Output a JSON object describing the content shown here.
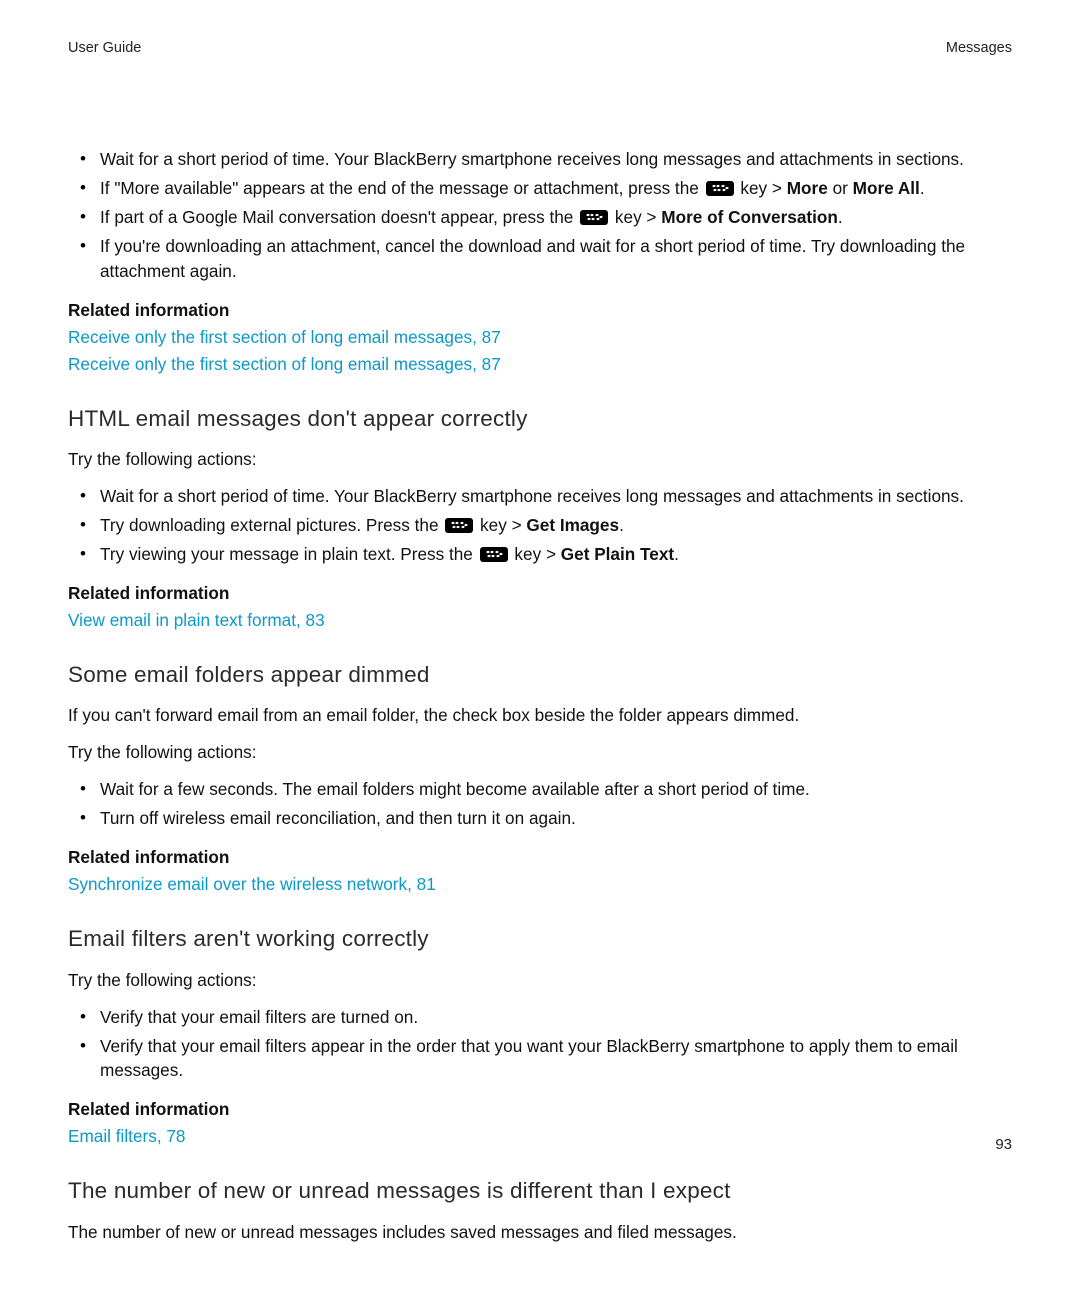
{
  "header": {
    "left": "User Guide",
    "right": "Messages"
  },
  "top_bullets": {
    "b1": "Wait for a short period of time. Your BlackBerry smartphone receives long messages and attachments in sections.",
    "b2a": "If \"More available\" appears at the end of the message or attachment, press the ",
    "b2b": " key > ",
    "b2c": "More",
    "b2d": " or ",
    "b2e": "More All",
    "b2f": ".",
    "b3a": "If part of a Google Mail conversation doesn't appear, press the ",
    "b3b": " key > ",
    "b3c": "More of Conversation",
    "b3d": ".",
    "b4": "If you're downloading an attachment, cancel the download and wait for a short period of time. Try downloading the attachment again."
  },
  "related1": {
    "label": "Related information",
    "link1": "Receive only the first section of long email messages, 87",
    "link2": "Receive only the first section of long email messages, 87"
  },
  "sec2": {
    "heading": "HTML email messages don't appear correctly",
    "intro": "Try the following actions:",
    "b1": "Wait for a short period of time. Your BlackBerry smartphone receives long messages and attachments in sections.",
    "b2a": "Try downloading external pictures. Press the ",
    "b2b": " key > ",
    "b2c": "Get Images",
    "b2d": ".",
    "b3a": "Try viewing your message in plain text. Press the ",
    "b3b": " key > ",
    "b3c": "Get Plain Text",
    "b3d": "."
  },
  "related2": {
    "label": "Related information",
    "link1": "View email in plain text format, 83"
  },
  "sec3": {
    "heading": "Some email folders appear dimmed",
    "p1": "If you can't forward email from an email folder, the check box beside the folder appears dimmed.",
    "p2": "Try the following actions:",
    "b1": "Wait for a few seconds. The email folders might become available after a short period of time.",
    "b2": "Turn off wireless email reconciliation, and then turn it on again."
  },
  "related3": {
    "label": "Related information",
    "link1": "Synchronize email over the wireless network, 81"
  },
  "sec4": {
    "heading": "Email filters aren't working correctly",
    "intro": "Try the following actions:",
    "b1": "Verify that your email filters are turned on.",
    "b2": "Verify that your email filters appear in the order that you want your BlackBerry smartphone to apply them to email messages."
  },
  "related4": {
    "label": "Related information",
    "link1": "Email filters, 78"
  },
  "sec5": {
    "heading": "The number of new or unread messages is different than I expect",
    "p1": "The number of new or unread messages includes saved messages and filed messages."
  },
  "page_number": "93"
}
